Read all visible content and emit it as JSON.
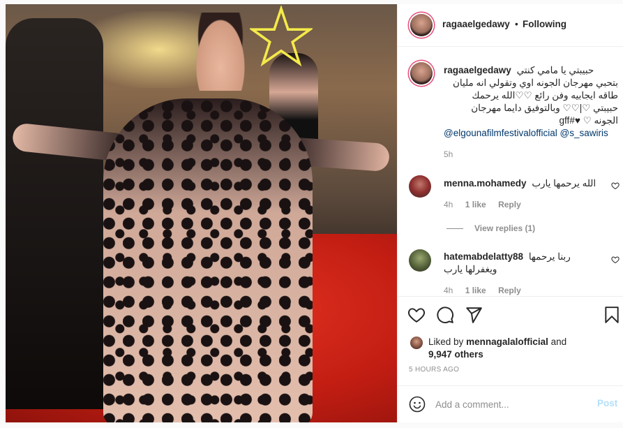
{
  "header": {
    "username": "ragaaelgedawy",
    "separator": "•",
    "follow_status": "Following",
    "more": "•••"
  },
  "caption": {
    "username": "ragaaelgedawy",
    "line1": "حبيبتي يا مامي كنتي",
    "line2": "بتحبي مهرجان الجونه اوي وتقولي انه مليان",
    "line3": "طاقه ايجابيه وفن رائع ♡♡الله يرحمك",
    "line4": "حبيبتي ♡|♡♡ وبالتوفيق دايما مهرجان",
    "line5": "الجونه ♡ ♥#gff",
    "mentions": "@elgounafilmfestivalofficial @s_sawiris",
    "time": "5h"
  },
  "comments": [
    {
      "username": "menna.mohamedy",
      "text": "الله يرحمها يارب",
      "time": "4h",
      "likes": "1 like",
      "reply": "Reply",
      "view_replies": "View replies (1)"
    },
    {
      "username": "hatemabdelatty88",
      "text": "ربنا يرحمها ويغفرلها يارب",
      "time": "4h",
      "likes": "1 like",
      "reply": "Reply"
    }
  ],
  "likes": {
    "prefix": "Liked by",
    "user": "mennagalalofficial",
    "and": "and",
    "others": "9,947 others"
  },
  "posted": "5 HOURS AGO",
  "add_comment": {
    "placeholder": "Add a comment...",
    "post_label": "Post"
  },
  "colors": {
    "accent_link": "#00376b",
    "post_disabled": "#b2dffc",
    "muted": "#8e8e8e",
    "story_ring": "#e94d7a"
  }
}
